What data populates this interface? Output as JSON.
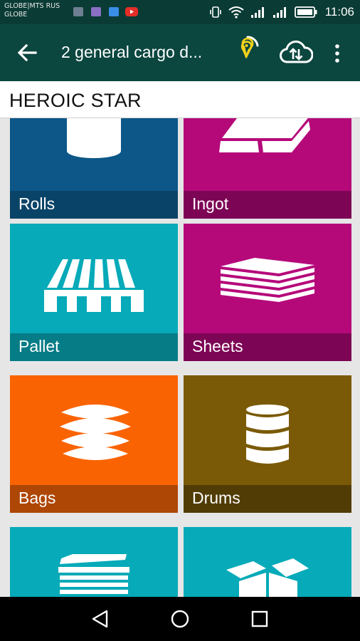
{
  "status_bar": {
    "carrier_line1": "GLOBE|MTS RUS",
    "carrier_line2": "GLOBE",
    "time": "11:06",
    "notification_icons": [
      {
        "icon": "gallery-icon",
        "color": "#6e7f92"
      },
      {
        "icon": "chat-icon",
        "color": "#8a6fc4"
      },
      {
        "icon": "messenger-icon",
        "color": "#3a8ee6"
      },
      {
        "icon": "youtube-icon",
        "color": "#e52d27"
      }
    ],
    "status_icons": [
      "vibrate-icon",
      "wifi-icon",
      "signal-icon",
      "signal-icon",
      "battery-icon"
    ]
  },
  "app_bar": {
    "title": "2 general cargo d...",
    "actions": [
      "gps-location-icon",
      "cloud-sync-icon",
      "more-vert-icon"
    ],
    "accent_color": "#f2d21b"
  },
  "vessel": {
    "name": "HEROIC STAR"
  },
  "cargo_tiles": [
    {
      "label": "Rolls",
      "icon": "rolls-icon",
      "color": "#0c5788",
      "label_color": "#0a4368"
    },
    {
      "label": "Ingot",
      "icon": "ingot-icon",
      "color": "#b5097a",
      "label_color": "#7d0555"
    },
    {
      "label": "Pallet",
      "icon": "pallet-icon",
      "color": "#06aab8",
      "label_color": "#057c86"
    },
    {
      "label": "Sheets",
      "icon": "sheets-icon",
      "color": "#b5097a",
      "label_color": "#7d0555"
    },
    {
      "label": "Bags",
      "icon": "bags-icon",
      "color": "#fa6302",
      "label_color": "#ae4605"
    },
    {
      "label": "Drums",
      "icon": "drums-icon",
      "color": "#7a5a06",
      "label_color": "#513c06"
    },
    {
      "label": "",
      "icon": "crate-icon",
      "color": "#06aab8",
      "label_color": "#057c86"
    },
    {
      "label": "",
      "icon": "open-box-icon",
      "color": "#06aab8",
      "label_color": "#057c86"
    }
  ],
  "nav_bar": [
    "back-triangle-icon",
    "home-circle-icon",
    "recents-square-icon"
  ]
}
